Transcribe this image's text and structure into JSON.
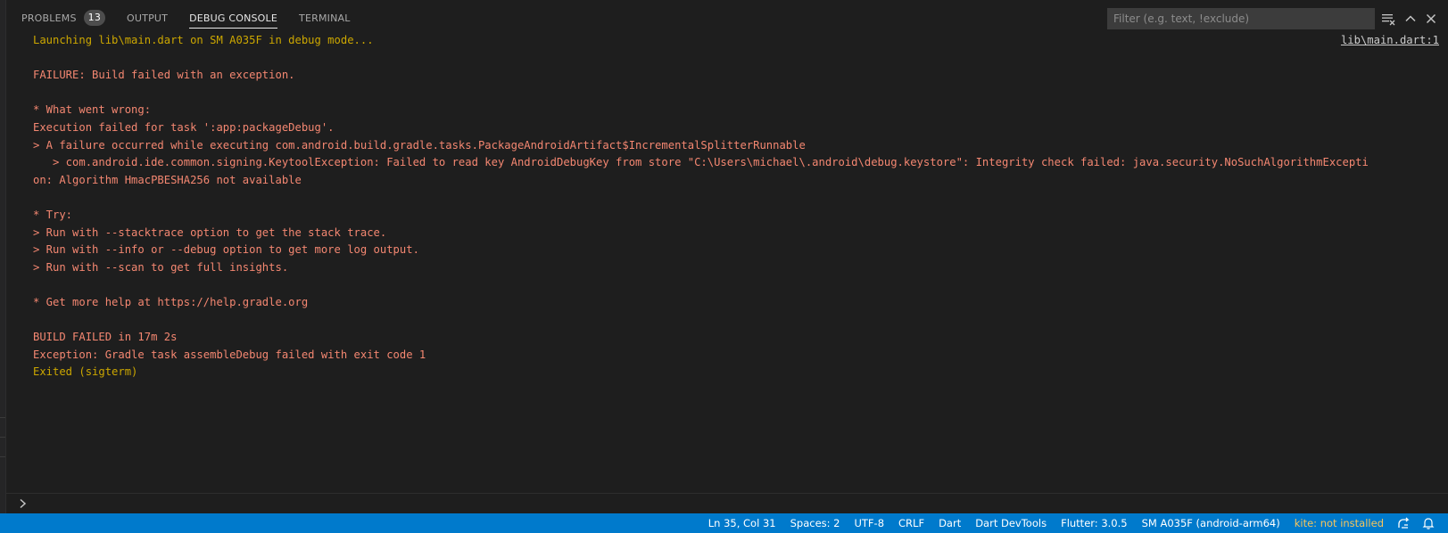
{
  "panel": {
    "tabs": [
      {
        "label": "PROBLEMS",
        "badge": "13"
      },
      {
        "label": "OUTPUT"
      },
      {
        "label": "DEBUG CONSOLE"
      },
      {
        "label": "TERMINAL"
      }
    ],
    "filter_placeholder": "Filter (e.g. text, !exclude)",
    "source_link": "lib\\main.dart:1"
  },
  "console": {
    "lines": [
      "Launching lib\\main.dart on SM A035F in debug mode...",
      "",
      "FAILURE: Build failed with an exception.",
      "",
      "* What went wrong:",
      "Execution failed for task ':app:packageDebug'.",
      "> A failure occurred while executing com.android.build.gradle.tasks.PackageAndroidArtifact$IncrementalSplitterRunnable",
      "   > com.android.ide.common.signing.KeytoolException: Failed to read key AndroidDebugKey from store \"C:\\Users\\michael\\.android\\debug.keystore\": Integrity check failed: java.security.NoSuchAlgorithmExcepti",
      "on: Algorithm HmacPBESHA256 not available",
      "",
      "* Try:",
      "> Run with --stacktrace option to get the stack trace.",
      "> Run with --info or --debug option to get more log output.",
      "> Run with --scan to get full insights.",
      "",
      "* Get more help at https://help.gradle.org",
      "",
      "BUILD FAILED in 17m 2s",
      "Exception: Gradle task assembleDebug failed with exit code 1",
      "Exited (sigterm)"
    ]
  },
  "statusbar": {
    "position": "Ln 35, Col 31",
    "spaces": "Spaces: 2",
    "encoding": "UTF-8",
    "eol": "CRLF",
    "language": "Dart",
    "devtools": "Dart DevTools",
    "flutter": "Flutter: 3.0.5",
    "device": "SM A035F (android-arm64)",
    "kite": "kite: not installed"
  },
  "colors": {
    "accent": "#007acc",
    "warning_text": "#cca700",
    "error_text": "#f48771",
    "background": "#1e1e1e"
  }
}
